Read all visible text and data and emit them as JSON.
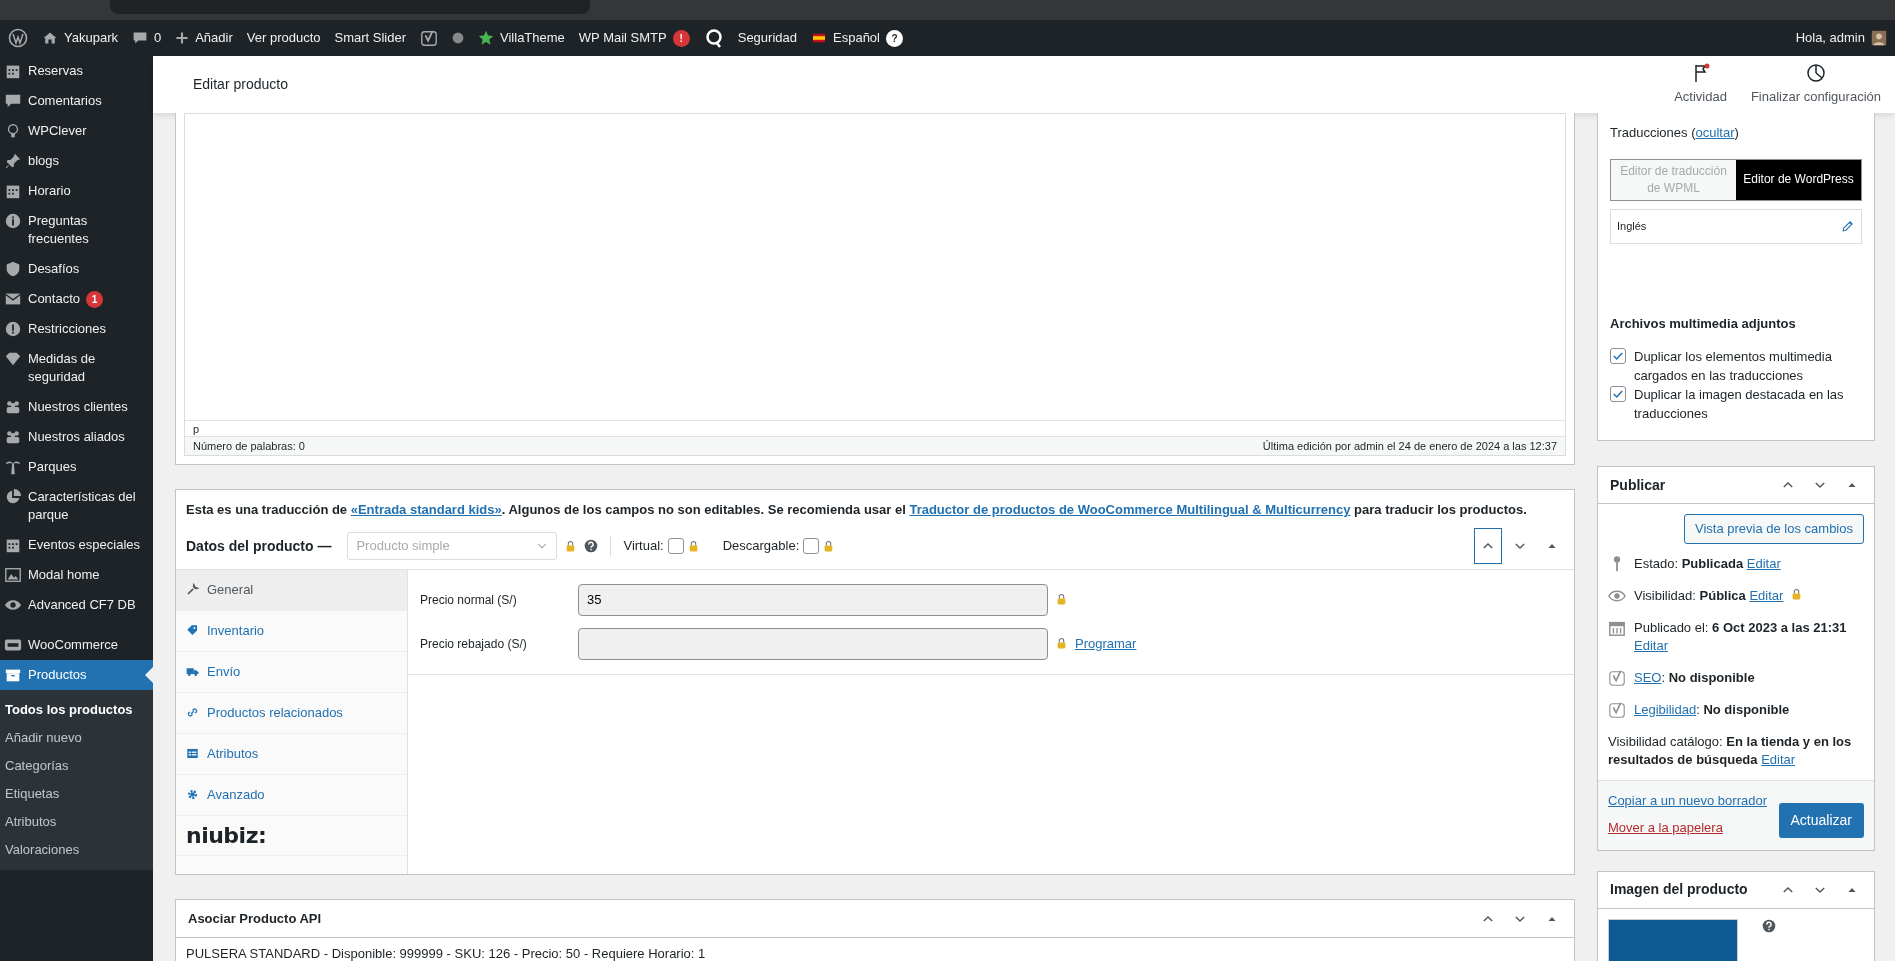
{
  "admin_bar": {
    "site": "Yakupark",
    "comments": "0",
    "items": [
      {
        "kind": "new",
        "label": "Añadir"
      },
      {
        "kind": "plain",
        "label": "Ver producto"
      },
      {
        "kind": "plain",
        "label": "Smart Slider"
      },
      {
        "kind": "yoast"
      },
      {
        "kind": "dot"
      },
      {
        "kind": "star",
        "label": "VillaTheme"
      },
      {
        "kind": "badge",
        "label": "WP Mail SMTP",
        "badge": "!"
      },
      {
        "kind": "q"
      },
      {
        "kind": "plain",
        "label": "Seguridad"
      },
      {
        "kind": "lang",
        "label": "Español",
        "badge": "?"
      }
    ],
    "greeting": "Hola, admin"
  },
  "sidebar": {
    "items": [
      {
        "label": "Reservas",
        "selected": false
      },
      {
        "label": "Comentarios",
        "selected": false
      },
      {
        "label": "WPClever",
        "selected": false
      },
      {
        "label": "blogs",
        "selected": false
      },
      {
        "label": "Horario",
        "selected": false
      },
      {
        "label": "Preguntas frecuentes",
        "selected": false
      },
      {
        "label": "Desafíos",
        "selected": false
      },
      {
        "label": "Contacto",
        "selected": false,
        "badge": "1"
      },
      {
        "label": "Restricciones",
        "selected": false
      },
      {
        "label": "Medidas de seguridad",
        "selected": false
      },
      {
        "label": "Nuestros clientes",
        "selected": false
      },
      {
        "label": "Nuestros aliados",
        "selected": false
      },
      {
        "label": "Parques",
        "selected": false
      },
      {
        "label": "Características del parque",
        "selected": false
      },
      {
        "label": "Eventos especiales",
        "selected": false
      },
      {
        "label": "Modal home",
        "selected": false
      },
      {
        "label": "Advanced CF7 DB",
        "selected": false
      },
      {
        "label": "WooCommerce",
        "selected": false
      },
      {
        "label": "Productos",
        "selected": true,
        "children": [
          {
            "label": "Todos los productos",
            "selected": true
          },
          {
            "label": "Añadir nuevo",
            "selected": false
          },
          {
            "label": "Categorías",
            "selected": false
          },
          {
            "label": "Etiquetas",
            "selected": false
          },
          {
            "label": "Atributos",
            "selected": false
          },
          {
            "label": "Valoraciones",
            "selected": false
          }
        ]
      }
    ]
  },
  "header": {
    "title": "Editar producto",
    "actions": [
      {
        "label": "Actividad",
        "kind": "flag"
      },
      {
        "label": "Finalizar configuración",
        "kind": "progress"
      }
    ]
  },
  "editor": {
    "path": "p",
    "word_count": "Número de palabras: 0",
    "last_edit": "Última edición por admin el 24 de enero de 2024 a las 12:37"
  },
  "product_data": {
    "notice": [
      {
        "kind": "text",
        "text": "Esta es una traducción de "
      },
      {
        "kind": "link",
        "text": "«Entrada standard kids»"
      },
      {
        "kind": "text",
        "text": ". Algunos de los campos no son editables. Se recomienda usar el "
      },
      {
        "kind": "link",
        "text": "Traductor de productos de WooCommerce Multilingual & Multicurrency"
      },
      {
        "kind": "text",
        "text": " para traducir los productos."
      }
    ],
    "title": "Datos del producto —",
    "type_select": "Producto simple",
    "options": [
      {
        "label": "Virtual:",
        "checked": false
      },
      {
        "label": "Descargable:",
        "checked": false
      }
    ],
    "tabs": [
      {
        "label": "General",
        "selected": true
      },
      {
        "label": "Inventario",
        "selected": false
      },
      {
        "label": "Envío",
        "selected": false
      },
      {
        "label": "Productos relacionados",
        "selected": false
      },
      {
        "label": "Atributos",
        "selected": false
      },
      {
        "label": "Avanzado",
        "selected": false
      }
    ],
    "brand_tab": "niubiz:",
    "fields": [
      {
        "label": "Precio normal (S/)",
        "value": "35",
        "locked": true
      },
      {
        "label": "Precio rebajado (S/)",
        "locked": true,
        "link": "Programar"
      }
    ]
  },
  "api_box": {
    "title": "Asociar Producto API",
    "line": "PULSERA STANDARD - Disponible: 999999 - SKU: 126 - Precio: 50 - Requiere Horario: 1"
  },
  "translations": {
    "heading": [
      {
        "kind": "text",
        "text": "Traducciones ("
      },
      {
        "kind": "link",
        "text": "ocultar"
      },
      {
        "kind": "text",
        "text": ")"
      }
    ],
    "editors": [
      {
        "label": "Editor de traducción de WPML",
        "selected": false
      },
      {
        "label": "Editor de WordPress",
        "selected": true
      }
    ],
    "language": "Inglés",
    "media_title": "Archivos multimedia adjuntos",
    "media_options": [
      {
        "label": "Duplicar los elementos multimedia cargados en las traducciones",
        "checked": true
      },
      {
        "label": "Duplicar la imagen destacada en las traducciones",
        "checked": true
      }
    ]
  },
  "publish": {
    "title": "Publicar",
    "preview_button": "Vista previa de los cambios",
    "rows": [
      {
        "kind": "status",
        "parts": [
          {
            "kind": "text",
            "text": "Estado: **Publicada** "
          },
          {
            "kind": "link",
            "text": "Editar"
          }
        ],
        "locked": false
      },
      {
        "kind": "visibility",
        "parts": [
          {
            "kind": "text",
            "text": "Visibilidad: **Pública** "
          },
          {
            "kind": "link",
            "text": "Editar"
          }
        ],
        "locked": true
      },
      {
        "kind": "date",
        "parts": [
          {
            "kind": "text",
            "text": "Publicado el: **6 Oct 2023 a las 21:31** "
          },
          {
            "kind": "link",
            "text": "Editar"
          }
        ],
        "locked": false
      },
      {
        "kind": "seo",
        "parts": [
          {
            "kind": "link",
            "text": "SEO"
          },
          {
            "kind": "text",
            "text": ": **No disponible**"
          }
        ],
        "locked": false
      },
      {
        "kind": "readability",
        "parts": [
          {
            "kind": "link",
            "text": "Legibilidad"
          },
          {
            "kind": "text",
            "text": ": **No disponible**"
          }
        ],
        "locked": false
      },
      {
        "kind": "catalog",
        "parts": [
          {
            "kind": "text",
            "text": "Visibilidad catálogo: **En la tienda y en los resultados de búsqueda** "
          },
          {
            "kind": "link",
            "text": "Editar"
          }
        ],
        "locked": false
      }
    ],
    "copy_link": "Copiar a un nuevo borrador",
    "trash_link": "Mover a la papelera",
    "update_button": "Actualizar"
  },
  "product_image": {
    "title": "Imagen del producto"
  }
}
